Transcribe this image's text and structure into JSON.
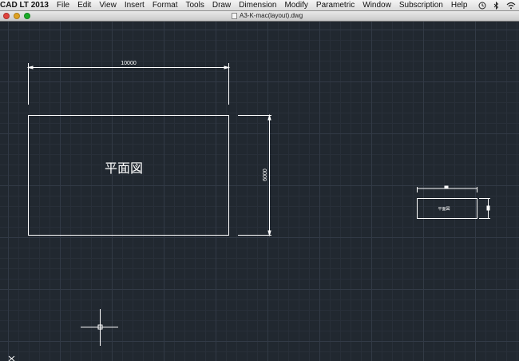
{
  "menubar": {
    "app_name": "CAD LT 2013",
    "items": [
      "File",
      "Edit",
      "View",
      "Insert",
      "Format",
      "Tools",
      "Draw",
      "Dimension",
      "Modify",
      "Parametric",
      "Window",
      "Subscription",
      "Help"
    ],
    "icons": [
      "time-machine-icon",
      "bluetooth-icon",
      "wifi-icon"
    ]
  },
  "titlebar": {
    "document_title": "A3-K-mac(layout).dwg"
  },
  "drawing": {
    "main_view": {
      "label": "平面図",
      "width_dimension": "10000",
      "height_dimension": "6000"
    },
    "thumbnail_view": {
      "label": "平面図"
    }
  },
  "colors": {
    "canvas_background": "#212830",
    "grid_major": "#323a46",
    "grid_minor": "#282f39",
    "drawing_lines": "#ffffff"
  }
}
